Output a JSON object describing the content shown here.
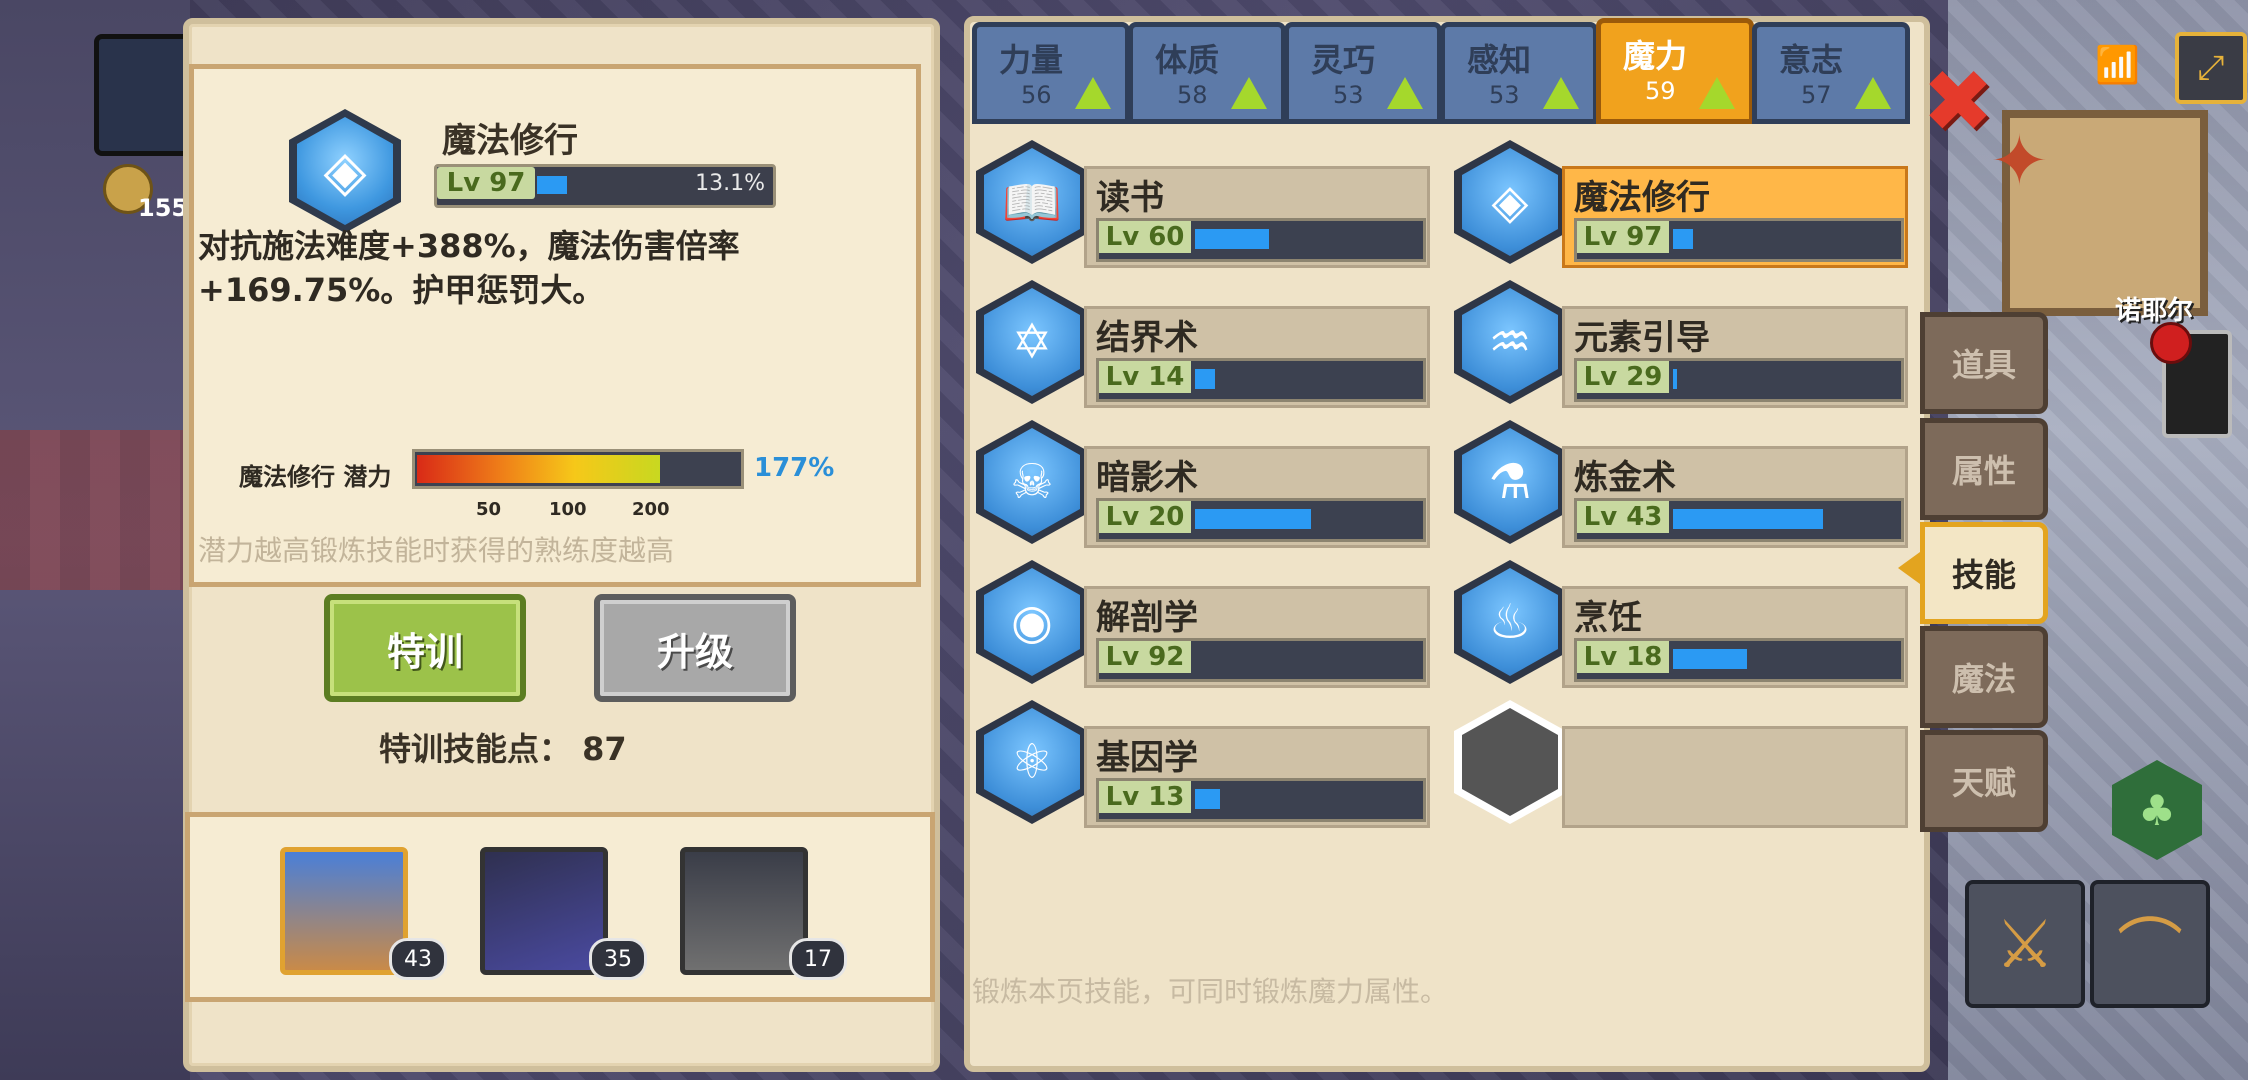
{
  "hud": {
    "gold": "155",
    "close_icon": "✖",
    "wifi_icon": "wifi-icon",
    "corner_icon": "⤢",
    "npc_name": "诺耶尔"
  },
  "attribute_tabs": [
    {
      "name": "力量",
      "value": "56"
    },
    {
      "name": "体质",
      "value": "58"
    },
    {
      "name": "灵巧",
      "value": "53"
    },
    {
      "name": "感知",
      "value": "53"
    },
    {
      "name": "魔力",
      "value": "59"
    },
    {
      "name": "意志",
      "value": "57"
    }
  ],
  "detail": {
    "title": "魔法修行",
    "level": "Lv 97",
    "progress_pct_label": "13.1%",
    "progress": 0.131,
    "description": "对抗施法难度+388%，魔法伤害倍率+169.75%。护甲惩罚大。",
    "potential_label": "魔法修行 潜力",
    "potential_pct": "177%",
    "potential": 0.76,
    "ticks": [
      "50",
      "100",
      "200"
    ],
    "hint": "潜力越高锻炼技能时获得的熟练度越高"
  },
  "buttons": {
    "train": "特训",
    "upgrade": "升级"
  },
  "train_points_label": "特训技能点： 87",
  "party": [
    {
      "level": "43"
    },
    {
      "level": "35"
    },
    {
      "level": "17"
    }
  ],
  "skills": [
    {
      "name": "读书",
      "level": "Lv 60",
      "progress": 0.33,
      "icon": "📖"
    },
    {
      "name": "魔法修行",
      "level": "Lv 97",
      "progress": 0.09,
      "icon": "◈"
    },
    {
      "name": "结界术",
      "level": "Lv 14",
      "progress": 0.09,
      "icon": "✡"
    },
    {
      "name": "元素引导",
      "level": "Lv 29",
      "progress": 0.02,
      "icon": "♒"
    },
    {
      "name": "暗影术",
      "level": "Lv 20",
      "progress": 0.52,
      "icon": "☠"
    },
    {
      "name": "炼金术",
      "level": "Lv 43",
      "progress": 0.67,
      "icon": "⚗"
    },
    {
      "name": "解剖学",
      "level": "Lv 92",
      "progress": 0.0,
      "icon": "◉"
    },
    {
      "name": "烹饪",
      "level": "Lv 18",
      "progress": 0.33,
      "icon": "♨"
    },
    {
      "name": "基因学",
      "level": "Lv 13",
      "progress": 0.11,
      "icon": "⚛"
    }
  ],
  "footer_hint": "锻炼本页技能，可同时锻炼魔力属性。",
  "side_tabs": [
    "道具",
    "属性",
    "技能",
    "魔法",
    "天赋"
  ]
}
